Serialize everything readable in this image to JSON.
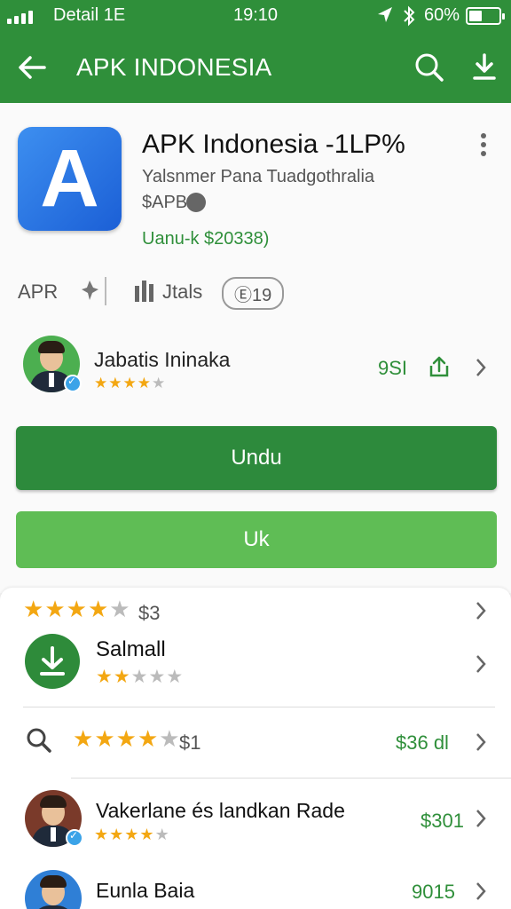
{
  "status_bar": {
    "carrier": "Detail 1E",
    "time": "19:10",
    "battery": "60%"
  },
  "toolbar": {
    "title": "APK INDONESIA",
    "back_icon": "arrow-left-icon",
    "search_icon": "search-icon",
    "download_icon": "download-icon"
  },
  "app": {
    "icon_letter": "A",
    "name": "APK Indonesia -1LP%",
    "developer": "Yalsnmer Pana Tuadgothralia",
    "price": "$APB",
    "download_size": "Uanu-k $20338)"
  },
  "meta": {
    "category": "APR",
    "stats_label": "Jtals",
    "badge": "Ⓔ19"
  },
  "developer_row": {
    "name": "Jabatis Ininaka",
    "rating_filled": 4,
    "rating_total": 5,
    "count": "9SI"
  },
  "buttons": {
    "primary": "Undu",
    "secondary": "Uk"
  },
  "sheet": {
    "rating_row": {
      "rating_filled": 4,
      "rating_total": 5,
      "price": "$3"
    },
    "small_row": {
      "title": "Salmall",
      "rating_filled": 2,
      "rating_total": 5
    },
    "search_row": {
      "rating_filled": 4,
      "rating_total": 5,
      "price": "$1",
      "value": "$36 dl"
    },
    "person_rows": [
      {
        "name": "Vakerlane és landkan Rade",
        "value": "$301",
        "rating_filled": 4,
        "rating_total": 5
      },
      {
        "name": "Eunla Baia",
        "value": "9015"
      }
    ]
  },
  "colors": {
    "brand_green": "#2f8f3a",
    "light_green": "#5fbd55",
    "star": "#f3a712",
    "app_icon_blue": "#1b5fd6"
  }
}
